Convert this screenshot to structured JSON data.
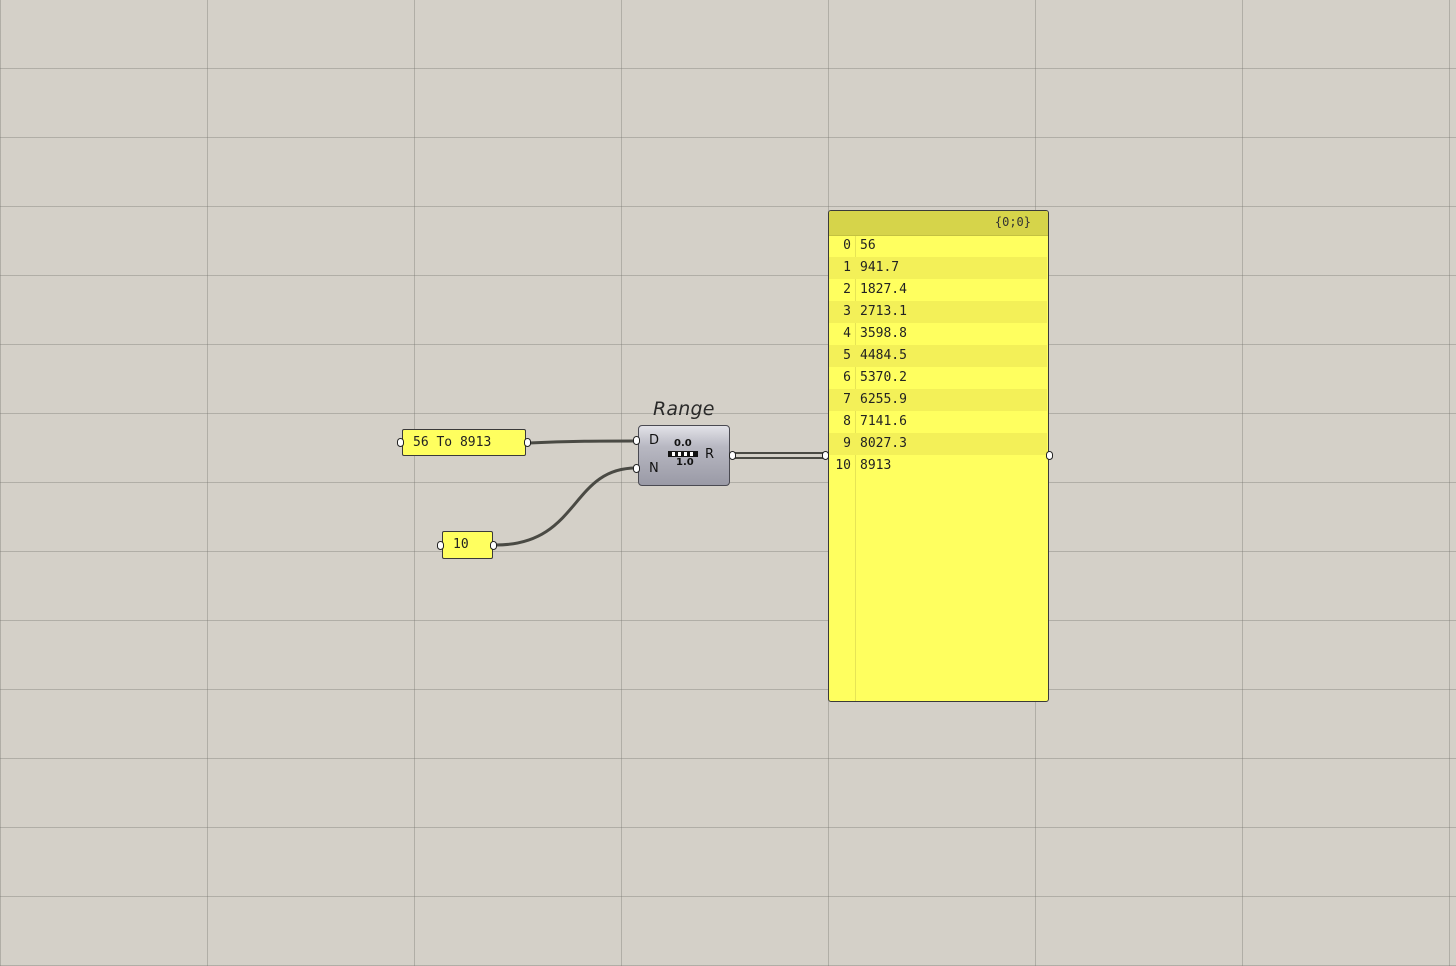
{
  "canvas": {
    "background_color": "#d4d0c8",
    "grid_color": "#a9a6a0"
  },
  "domain_panel": {
    "text": "56 To 8913"
  },
  "count_panel": {
    "text": "10"
  },
  "range_component": {
    "title": "Range",
    "inputs": [
      "D",
      "N"
    ],
    "outputs": [
      "R"
    ],
    "icon": "range-slider-icon",
    "icon_top_label": "0.0",
    "icon_bottom_label": "1.0"
  },
  "output_panel": {
    "path": "{0;0}",
    "color": "#ffff5f",
    "header_color": "#d6d44a",
    "rows": [
      {
        "index": "0",
        "value": "56"
      },
      {
        "index": "1",
        "value": "941.7"
      },
      {
        "index": "2",
        "value": "1827.4"
      },
      {
        "index": "3",
        "value": "2713.1"
      },
      {
        "index": "4",
        "value": "3598.8"
      },
      {
        "index": "5",
        "value": "4484.5"
      },
      {
        "index": "6",
        "value": "5370.2"
      },
      {
        "index": "7",
        "value": "6255.9"
      },
      {
        "index": "8",
        "value": "7141.6"
      },
      {
        "index": "9",
        "value": "8027.3"
      },
      {
        "index": "10",
        "value": "8913"
      }
    ]
  }
}
